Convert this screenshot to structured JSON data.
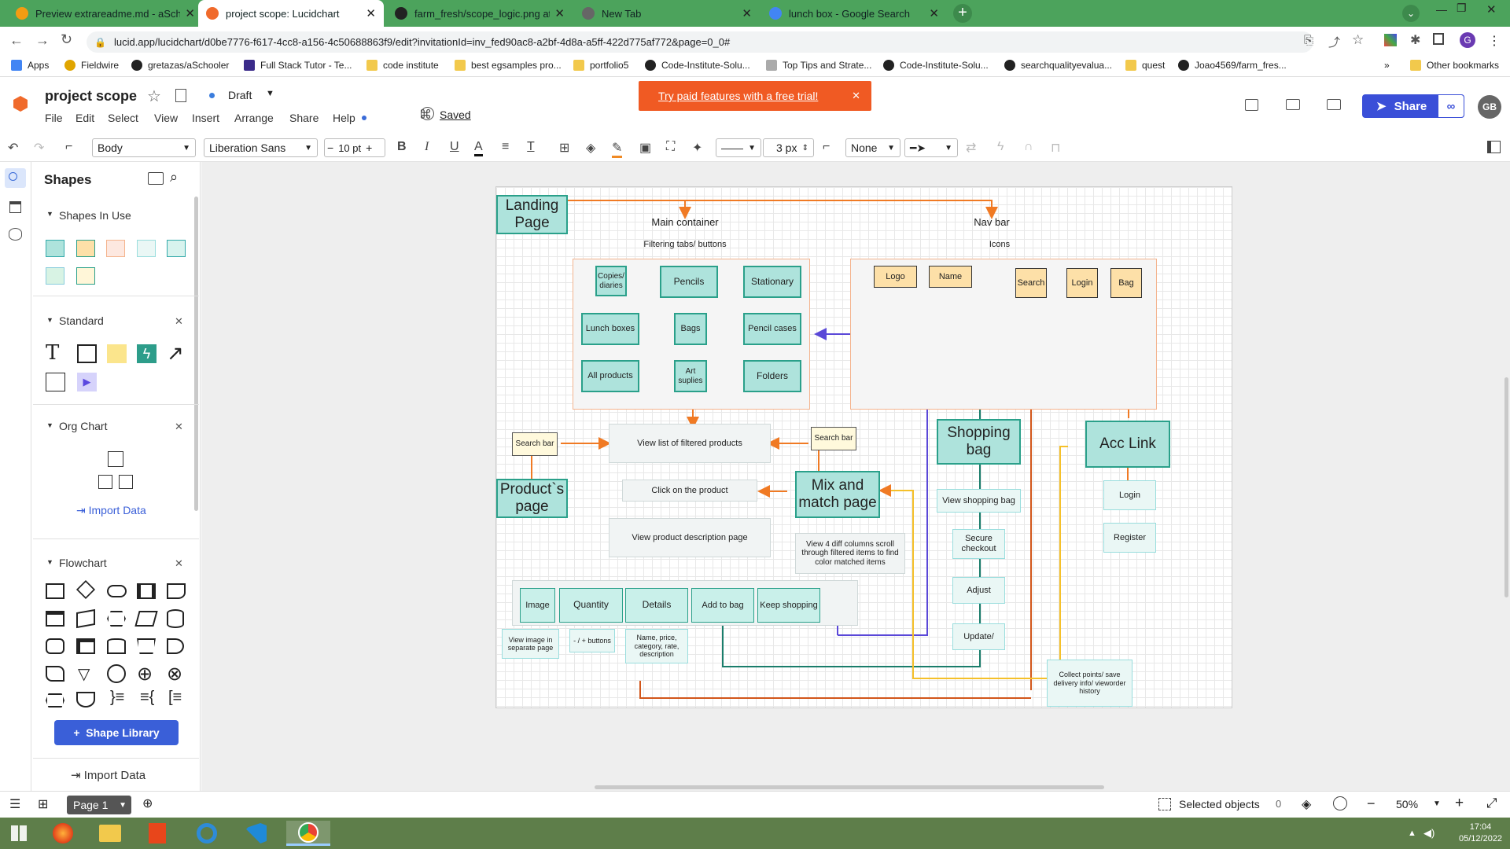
{
  "browser": {
    "tabs": [
      {
        "label": "Preview extrareadme.md - aScho",
        "color": "#f39c12",
        "active": false
      },
      {
        "label": "project scope: Lucidchart",
        "color": "#f06a2b",
        "active": true
      },
      {
        "label": "farm_fresh/scope_logic.png at m",
        "color": "#222",
        "active": false
      },
      {
        "label": "New Tab",
        "color": "#666",
        "active": false
      },
      {
        "label": "lunch box - Google Search",
        "color": "#4285f4",
        "active": false
      }
    ],
    "url": "lucid.app/lucidchart/d0be7776-f617-4cc8-a156-4c50688863f9/edit?invitationId=inv_fed90ac8-a2bf-4d8a-a5ff-422d775af772&page=0_0#",
    "bookmarks": [
      "Apps",
      "Fieldwire",
      "gretazas/aSchooler",
      "Full Stack Tutor - Te...",
      "code institute",
      "best egsamples pro...",
      "portfolio5",
      "Code-Institute-Solu...",
      "Top Tips and Strate...",
      "Code-Institute-Solu...",
      "searchqualityevalua...",
      "quest",
      "Joao4569/farm_fres..."
    ],
    "other_bookmarks": "Other bookmarks",
    "profile_initial": "G"
  },
  "doc": {
    "title": "project scope",
    "status": "Draft",
    "saved": "Saved",
    "banner": "Try paid features with a free trial!",
    "share": "Share",
    "avatar": "GB"
  },
  "menu": [
    "File",
    "Edit",
    "Select",
    "View",
    "Insert",
    "Arrange",
    "Share",
    "Help"
  ],
  "toolbar": {
    "style": "Body",
    "font": "Liberation Sans",
    "size": "10 pt",
    "line_width": "3 px",
    "end_style": "None"
  },
  "panel": {
    "title": "Shapes",
    "sections": [
      "Shapes In Use",
      "Standard",
      "Org Chart",
      "Flowchart"
    ],
    "import_data": "Import Data",
    "shape_library": "Shape Library",
    "import_data_bottom": "Import Data"
  },
  "diagram": {
    "landing": "Landing Page",
    "main_container": "Main container",
    "nav_bar": "Nav bar",
    "filtering": "Filtering tabs/ buttons",
    "icons": "Icons",
    "filters": [
      "Copies/ diaries",
      "Pencils",
      "Stationary",
      "Lunch boxes",
      "Bags",
      "Pencil cases",
      "All products",
      "Art suplies",
      "Folders"
    ],
    "nav_items": [
      "Logo",
      "Name",
      "Search",
      "Login",
      "Bag"
    ],
    "search_bar": "Search bar",
    "view_list": "View list of filtered products",
    "search_bar2": "Search bar",
    "product_page": "Product`s page",
    "click_product": "Click on the product",
    "mix_match": "Mix and match page",
    "view_desc": "View product description page",
    "view4": "View 4 diff columns scroll through filtered items to find color matched items",
    "detail_row": [
      "Image",
      "Quantity",
      "Details",
      "Add to bag",
      "Keep shopping"
    ],
    "view_image": "View image in separate page",
    "plusminus": "- / + buttons",
    "name_price": "Name, price, category, rate, description",
    "shopping_bag": "Shopping bag",
    "view_bag": "View shopping bag",
    "secure": "Secure checkout",
    "adjust": "Adjust",
    "update": "Update/",
    "acc_link": "Acc Link",
    "login": "Login",
    "register": "Register",
    "collect": "Collect points/ save delivery info/ vieworder history"
  },
  "status": {
    "page": "Page 1",
    "selected": "Selected objects",
    "count": "0",
    "zoom": "50%"
  },
  "clock": {
    "time": "17:04",
    "date": "05/12/2022"
  }
}
